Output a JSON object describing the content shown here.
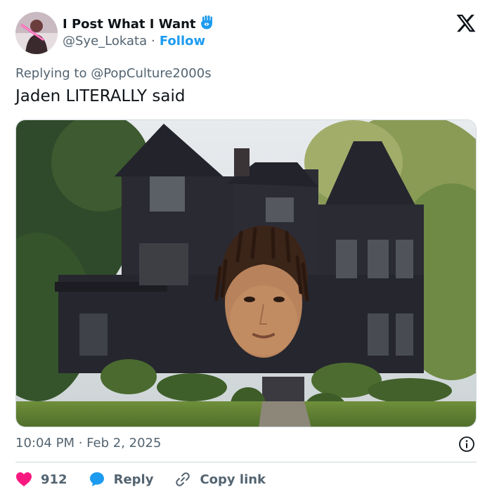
{
  "author": {
    "display_name": "I Post What I Want",
    "handle": "@Sye_Lokata",
    "separator": "·",
    "follow_label": "Follow",
    "badge_icon": "hamsa-icon"
  },
  "reply_context": {
    "prefix": "Replying to",
    "mention": "@PopCulture2000s"
  },
  "tweet": {
    "text": "Jaden LITERALLY said",
    "timestamp": "10:04 PM · Feb 2, 2025"
  },
  "actions": {
    "likes": "912",
    "reply_label": "Reply",
    "copy_label": "Copy link"
  },
  "colors": {
    "accent": "#1d9bf0",
    "like": "#f91880",
    "muted": "#536471",
    "text": "#0f1419"
  }
}
